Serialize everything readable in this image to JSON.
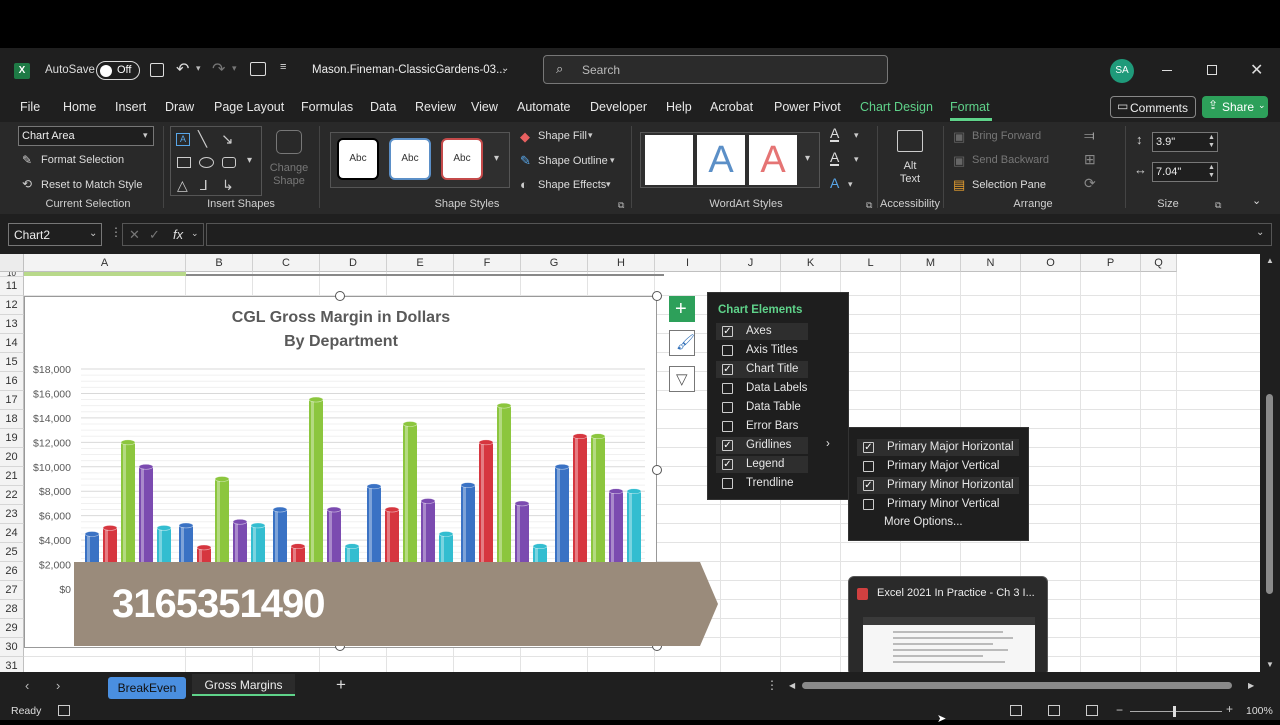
{
  "titlebar": {
    "autosave_label": "AutoSave",
    "autosave_state": "Off",
    "filename": "Mason.Fineman-ClassicGardens-03...",
    "search_placeholder": "Search",
    "avatar": "SA"
  },
  "tabs": [
    "File",
    "Home",
    "Insert",
    "Draw",
    "Page Layout",
    "Formulas",
    "Data",
    "Review",
    "View",
    "Automate",
    "Developer",
    "Help",
    "Acrobat",
    "Power Pivot",
    "Chart Design",
    "Format"
  ],
  "actions": {
    "comments": "Comments",
    "share": "Share"
  },
  "ribbon": {
    "current_selection": {
      "dropdown": "Chart Area",
      "format_selection": "Format Selection",
      "reset": "Reset to Match Style",
      "group": "Current Selection"
    },
    "insert_shapes": {
      "change_shape": "Change Shape",
      "group": "Insert Shapes"
    },
    "shape_styles": {
      "style_sample": "Abc",
      "fill": "Shape Fill",
      "outline": "Shape Outline",
      "effects": "Shape Effects",
      "group": "Shape Styles"
    },
    "wordart": {
      "sample": "A",
      "group": "WordArt Styles"
    },
    "accessibility": {
      "alt_text": "Alt Text",
      "group": "Accessibility"
    },
    "arrange": {
      "bring_forward": "Bring Forward",
      "send_backward": "Send Backward",
      "selection_pane": "Selection Pane",
      "group": "Arrange"
    },
    "size": {
      "height": "3.9\"",
      "width": "7.04\"",
      "group": "Size"
    }
  },
  "formula_bar": {
    "name_box": "Chart2",
    "fx": "fx",
    "value": ""
  },
  "columns": [
    "A",
    "B",
    "C",
    "D",
    "E",
    "F",
    "G",
    "H",
    "I",
    "J",
    "K",
    "L",
    "M",
    "N",
    "O",
    "P",
    "Q"
  ],
  "rows": [
    "11",
    "12",
    "13",
    "14",
    "15",
    "16",
    "17",
    "18",
    "19",
    "20",
    "21",
    "22",
    "23",
    "24",
    "25",
    "26",
    "27",
    "28",
    "29",
    "30",
    "31"
  ],
  "row_top_partial": "10",
  "chart_data": {
    "type": "bar",
    "title": "CGL Gross Margin in Dollars",
    "subtitle": "By Department",
    "ylim": [
      0,
      18000
    ],
    "yticks": [
      "$0",
      "$2,000",
      "$4,000",
      "$6,000",
      "$8,000",
      "$10,000",
      "$12,000",
      "$14,000",
      "$16,000",
      "$18,000"
    ],
    "grid": true,
    "groups": [
      {
        "values": [
          4500,
          5000,
          12000,
          10000,
          5000
        ],
        "colors": [
          "#3a72c4",
          "#d6363f",
          "#8cc63e",
          "#7b4bb0",
          "#33bdd0"
        ]
      },
      {
        "values": [
          5200,
          3400,
          9000,
          5500,
          5200
        ],
        "colors": [
          "#3a72c4",
          "#d6363f",
          "#8cc63e",
          "#7b4bb0",
          "#33bdd0"
        ]
      },
      {
        "values": [
          6500,
          3500,
          15500,
          6500,
          3500
        ],
        "colors": [
          "#3a72c4",
          "#d6363f",
          "#8cc63e",
          "#7b4bb0",
          "#33bdd0"
        ]
      },
      {
        "values": [
          8400,
          6500,
          13500,
          7200,
          4500
        ],
        "colors": [
          "#3a72c4",
          "#d6363f",
          "#8cc63e",
          "#7b4bb0",
          "#33bdd0"
        ]
      },
      {
        "values": [
          8500,
          12000,
          15000,
          7000,
          3500
        ],
        "colors": [
          "#3a72c4",
          "#d6363f",
          "#8cc63e",
          "#7b4bb0",
          "#33bdd0"
        ]
      },
      {
        "values": [
          10000,
          12500,
          12500,
          8000,
          8000
        ],
        "colors": [
          "#3a72c4",
          "#d6363f",
          "#8cc63e",
          "#7b4bb0",
          "#33bdd0"
        ]
      }
    ]
  },
  "overlay_number": "3165351490",
  "chart_elements": {
    "header": "Chart Elements",
    "items": [
      {
        "label": "Axes",
        "checked": true
      },
      {
        "label": "Axis Titles",
        "checked": false
      },
      {
        "label": "Chart Title",
        "checked": true
      },
      {
        "label": "Data Labels",
        "checked": false
      },
      {
        "label": "Data Table",
        "checked": false
      },
      {
        "label": "Error Bars",
        "checked": false
      },
      {
        "label": "Gridlines",
        "checked": true
      },
      {
        "label": "Legend",
        "checked": true
      },
      {
        "label": "Trendline",
        "checked": false
      }
    ]
  },
  "gridlines_submenu": {
    "items": [
      {
        "label": "Primary Major Horizontal",
        "checked": true
      },
      {
        "label": "Primary Major Vertical",
        "checked": false
      },
      {
        "label": "Primary Minor Horizontal",
        "checked": true
      },
      {
        "label": "Primary Minor Vertical",
        "checked": false
      }
    ],
    "more": "More Options..."
  },
  "sheets": [
    "BreakEven",
    "Gross Margins"
  ],
  "taskbar_preview": {
    "title": "Excel 2021 In Practice - Ch 3 I..."
  },
  "status": {
    "ready": "Ready",
    "zoom": "100%"
  },
  "colors": {
    "accent_green": "#5fd38a",
    "share_green": "#2da05a",
    "sheet_blue": "#4a8fe0"
  }
}
